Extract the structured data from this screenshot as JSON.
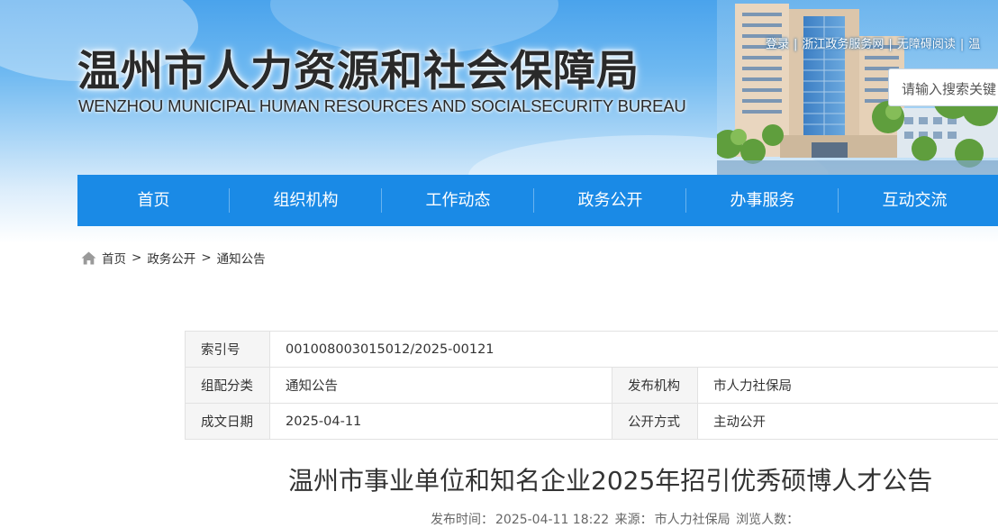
{
  "header": {
    "title": "温州市人力资源和社会保障局",
    "subtitle": "WENZHOU MUNICIPAL HUMAN RESOURCES AND SOCIALSECURITY BUREAU",
    "top_links": [
      "登录",
      "浙江政务服务网",
      "无障碍阅读",
      "温"
    ],
    "search_placeholder": "请输入搜索关键"
  },
  "nav": {
    "items": [
      "首页",
      "组织机构",
      "工作动态",
      "政务公开",
      "办事服务",
      "互动交流"
    ]
  },
  "breadcrumb": {
    "home": "首页",
    "level1": "政务公开",
    "level2": "通知公告",
    "separator": ">"
  },
  "meta": {
    "index_label": "索引号",
    "index_value": "001008003015012/2025-00121",
    "category_label": "组配分类",
    "category_value": "通知公告",
    "publisher_label": "发布机构",
    "publisher_value": "市人力社保局",
    "date_label": "成文日期",
    "date_value": "2025-04-11",
    "open_label": "公开方式",
    "open_value": "主动公开"
  },
  "article": {
    "title": "温州市事业单位和知名企业2025年招引优秀硕博人才公告",
    "publish_time_label": "发布时间：",
    "publish_time": "2025-04-11 18:22",
    "source_label": "来源：",
    "source": "市人力社保局",
    "views_label": "浏览人数："
  },
  "colors": {
    "nav_bg": "#1a8ae6",
    "header_sky": "#4aa3ec",
    "table_label_bg": "#f5f5f5"
  }
}
